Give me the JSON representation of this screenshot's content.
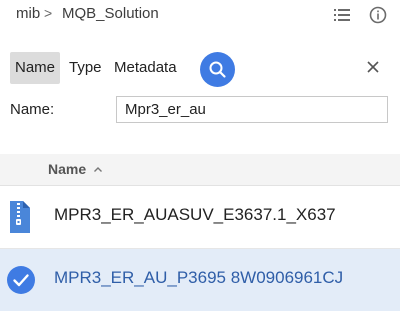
{
  "breadcrumb": {
    "root": "mib",
    "separator": ">",
    "current": "MQB_Solution"
  },
  "toolbar": {
    "list_view_icon": "list-view-icon",
    "info_icon": "info-icon"
  },
  "filter": {
    "chips": [
      "Name",
      "Type",
      "Metadata"
    ],
    "active_chip": "Name",
    "search_icon": "search-icon",
    "close_icon": "close-icon"
  },
  "name_field": {
    "label": "Name:",
    "value": "Mpr3_er_au"
  },
  "list": {
    "header": {
      "column": "Name",
      "sort": "ascending"
    },
    "rows": [
      {
        "name": "MPR3_ER_AUASUV_E3637.1_X637",
        "icon": "zip-file-icon",
        "selected": false
      },
      {
        "name": "MPR3_ER_AU_P3695 8W0906961CJ",
        "icon": "check-circle-icon",
        "selected": true
      }
    ]
  },
  "colors": {
    "accent": "#3f7be3",
    "selected_row": "#e3ecf8",
    "selected_text": "#2f5ea8"
  }
}
